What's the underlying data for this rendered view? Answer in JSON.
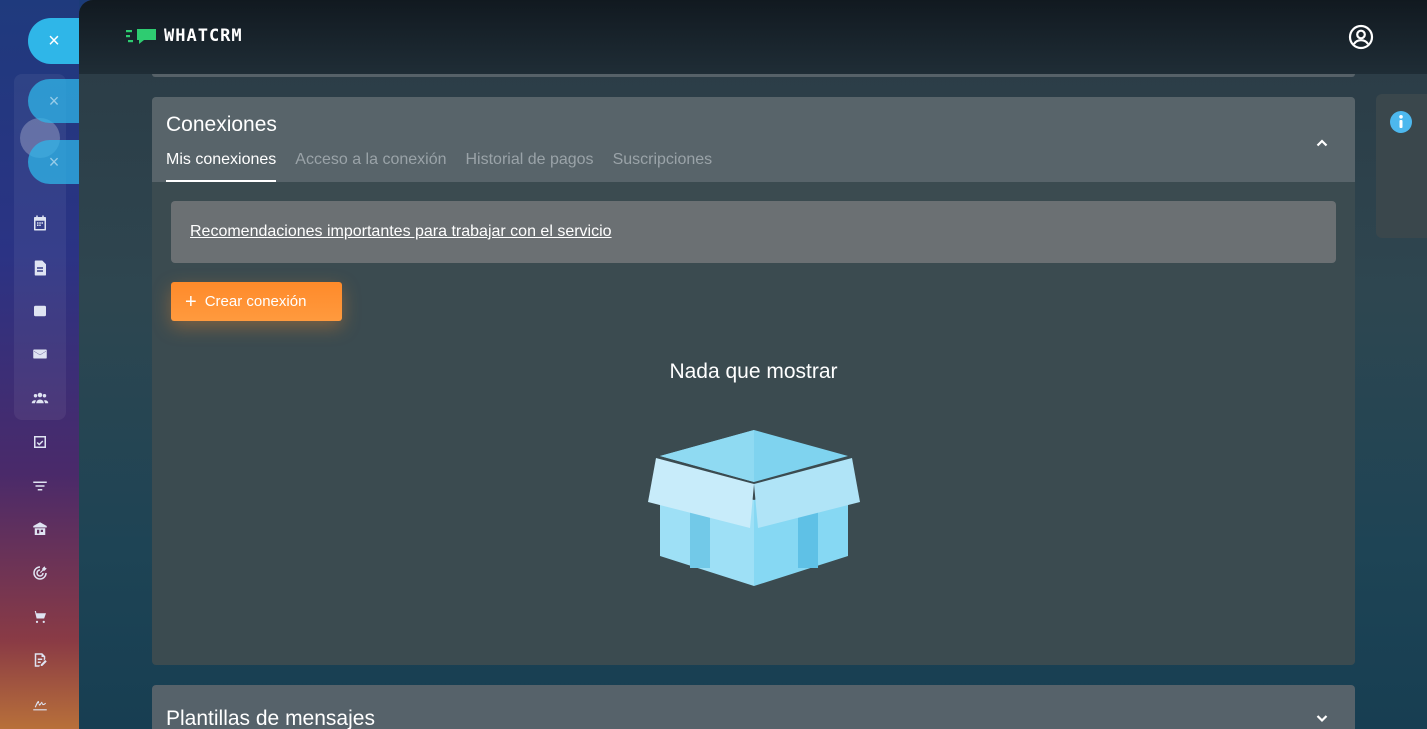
{
  "brand": {
    "name": "WHATCRM",
    "accent": "#2ecc71"
  },
  "sidebar": {
    "icons": [
      "close-icon",
      "chat-icon",
      "calendar-icon",
      "document-icon",
      "inbox-icon",
      "mail-icon",
      "users-icon",
      "task-icon",
      "filter-icon",
      "store-icon",
      "target-icon",
      "cart-icon",
      "edit-icon",
      "signature-icon"
    ],
    "close_glyph": "×"
  },
  "connections": {
    "title": "Conexiones",
    "tabs": [
      {
        "label": "Mis conexiones",
        "active": true
      },
      {
        "label": "Acceso a la conexión",
        "active": false
      },
      {
        "label": "Historial de pagos",
        "active": false
      },
      {
        "label": "Suscripciones",
        "active": false
      }
    ],
    "notice_link": "Recomendaciones importantes para trabajar con el servicio",
    "create_button": "Crear conexión",
    "create_glyph": "+",
    "empty_text": "Nada que mostrar"
  },
  "templates": {
    "title": "Plantillas de mensajes"
  },
  "colors": {
    "primary_button": "#ff8a2a",
    "close_bubble": "#2fb6e8",
    "info": "#4db8ee"
  }
}
